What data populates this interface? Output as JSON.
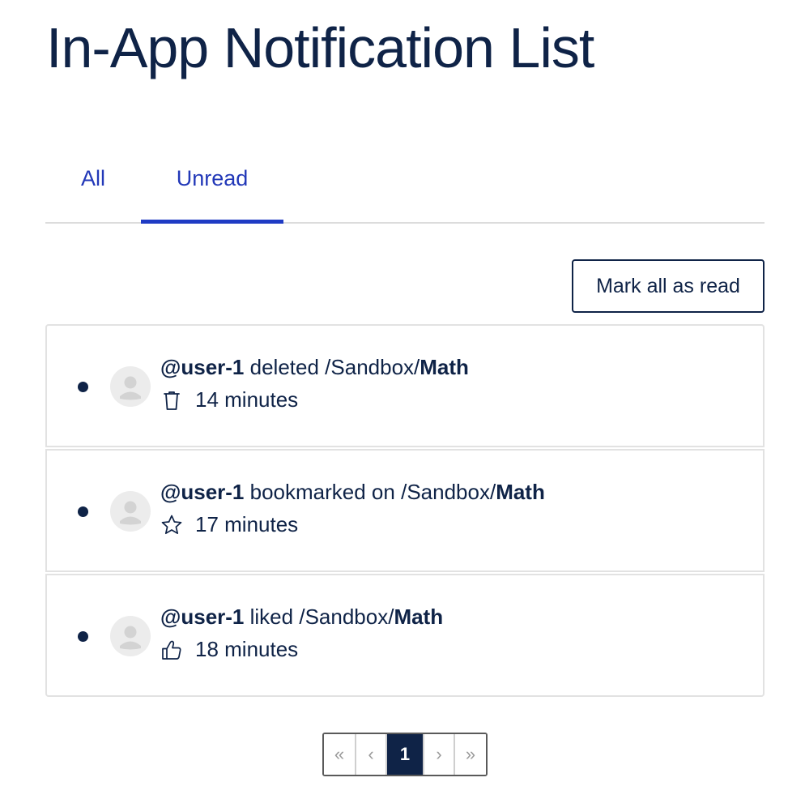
{
  "page": {
    "title": "In-App Notification List"
  },
  "tabs": [
    {
      "label": "All",
      "active": false
    },
    {
      "label": "Unread",
      "active": true
    }
  ],
  "actions": {
    "mark_all_label": "Mark all as read"
  },
  "notifications": [
    {
      "user": "@user-1",
      "action": "deleted",
      "path_prefix": "/Sandbox/",
      "path_name": "Math",
      "icon": "trash-icon",
      "time": "14 minutes",
      "unread": true
    },
    {
      "user": "@user-1",
      "action": "bookmarked on",
      "path_prefix": "/Sandbox/",
      "path_name": "Math",
      "icon": "star-icon",
      "time": "17 minutes",
      "unread": true
    },
    {
      "user": "@user-1",
      "action": "liked",
      "path_prefix": "/Sandbox/",
      "path_name": "Math",
      "icon": "thumbs-up-icon",
      "time": "18 minutes",
      "unread": true
    }
  ],
  "pagination": {
    "first": "«",
    "prev": "‹",
    "current": "1",
    "next": "›",
    "last": "»"
  },
  "colors": {
    "primary": "#0f2347",
    "tab_accent": "#1f3bc4",
    "border": "#e2e2e2",
    "avatar_bg": "#ececec"
  }
}
